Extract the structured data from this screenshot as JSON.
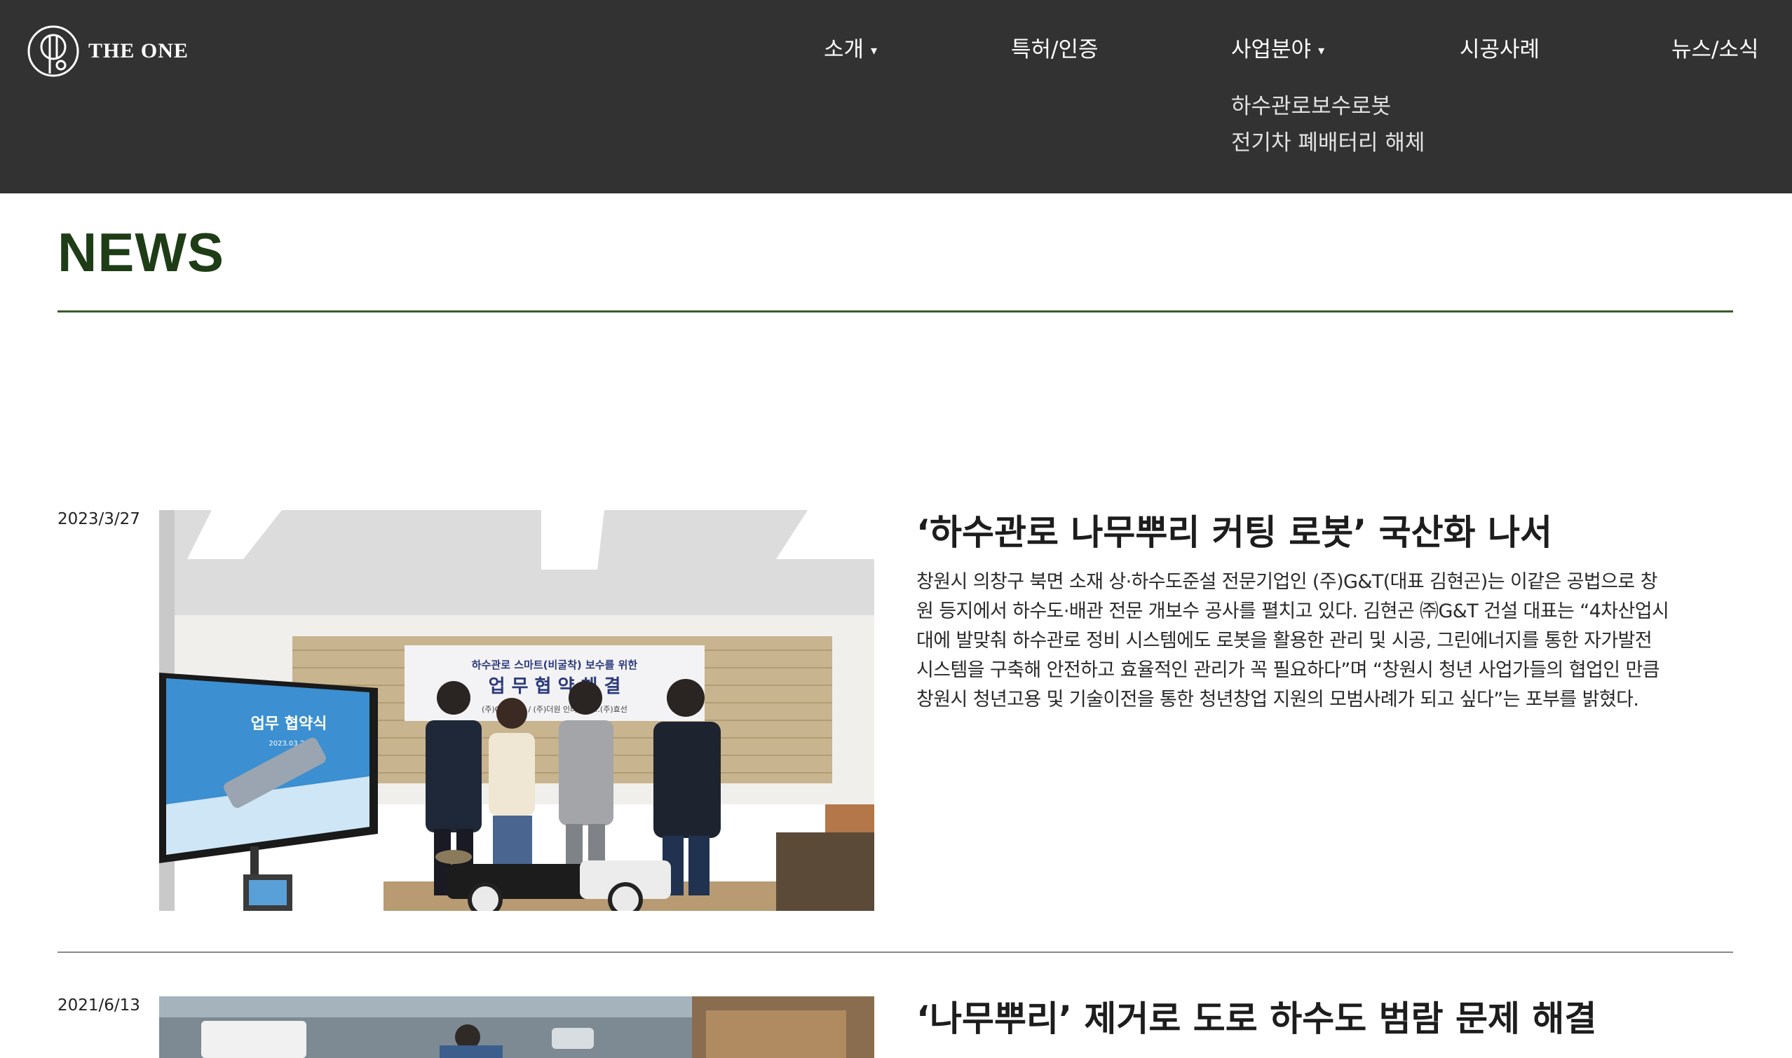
{
  "brand": {
    "name": "THE ONE",
    "logo_icon": "the-one-logo-mark"
  },
  "nav": {
    "items": [
      {
        "label": "소개",
        "has_dropdown": true
      },
      {
        "label": "특허/인증",
        "has_dropdown": false
      },
      {
        "label": "사업분야",
        "has_dropdown": true
      },
      {
        "label": "시공사례",
        "has_dropdown": false
      },
      {
        "label": "뉴스/소식",
        "has_dropdown": false
      }
    ],
    "caret_glyph": "▾",
    "open_submenu": {
      "parent": "사업분야",
      "items": [
        "하수관로보수로봇",
        "전기차 폐배터리 해체"
      ]
    }
  },
  "page": {
    "title": "NEWS"
  },
  "news": [
    {
      "date": "2023/3/27",
      "title": "‘하수관로 나무뿌리 커팅 로봇’ 국산화 나서",
      "body": "창원시 의창구 북면 소재 상·하수도준설 전문기업인 (주)G&T(대표 김현곤)는 이같은 공법으로 창원 등지에서 하수도·배관 전문 개보수 공사를 펼치고 있다. 김현곤 ㈜G&T 건설 대표는 “4차산업시대에 발맞춰 하수관로 정비 시스템에도 로봇을 활용한 관리 및 시공, 그린에너지를 통한 자가발전 시스템을 구축해 안전하고 효율적인 관리가 꼭 필요하다”며 “창원시 청년 사업가들의 협업인 만큼 창원시 청년고용 및 기술이전을 통한 청년창업 지원의 모범사례가 되고 싶다”는 포부를 밝혔다.",
      "image_alt": "업무협약 체결 기념 사진",
      "banner_line1": "하수관로 스마트(비굴착) 보수를 위한",
      "banner_line2": "업 무 협 약 체 결",
      "banner_line3": "(주)G&T건설 / (주)더원 인터… / …(주)효선",
      "screen_title": "업무 협약식",
      "screen_date": "2023.03.27"
    },
    {
      "date": "2021/6/13",
      "title": "‘나무뿌리’ 제거로 도로 하수도 범람 문제 해결",
      "body": "",
      "image_alt": "하수도 작업 현장 사진"
    }
  ],
  "colors": {
    "header_bg": "#323232",
    "title_green": "#1e3d17",
    "rule_green": "#3a5a2c"
  }
}
